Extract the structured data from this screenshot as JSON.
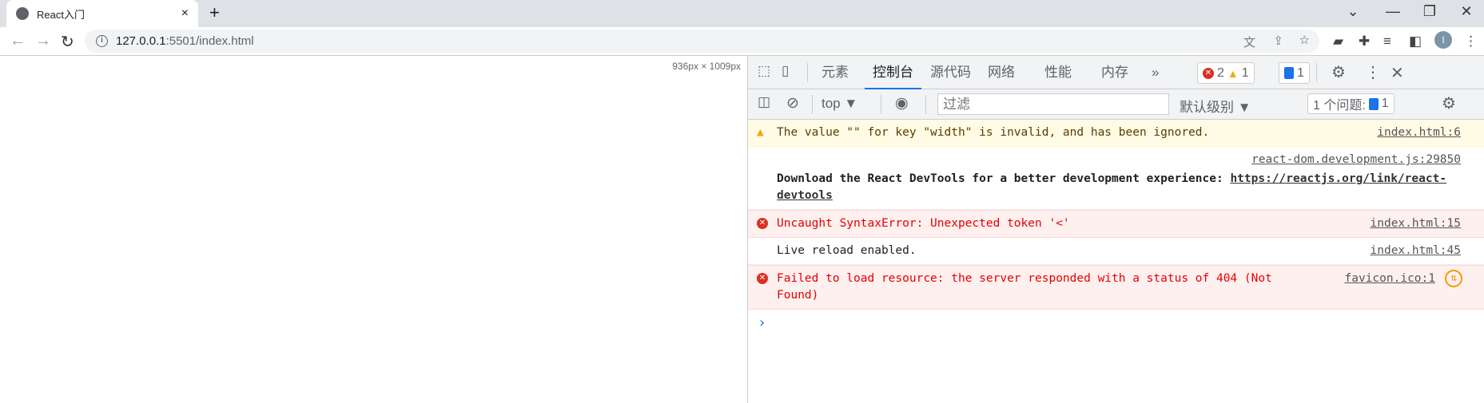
{
  "browser": {
    "tab_title": "React入门",
    "url_host": "127.0.0.1",
    "url_path": ":5501/index.html",
    "new_tab": "+",
    "tab_close": "×",
    "avatar_initial": "I"
  },
  "viewport": {
    "dimensions": "936px × 1009px"
  },
  "devtools": {
    "tabs": [
      "元素",
      "控制台",
      "源代码",
      "网络",
      "性能",
      "内存"
    ],
    "active_tab": "控制台",
    "more": "»",
    "error_count": "2",
    "warning_count": "1",
    "message_count": "1",
    "context": "top ▼",
    "filter_placeholder": "过滤",
    "level": "默认级别 ▼",
    "issues_label": "1 个问题:",
    "issues_count": "1",
    "colors": {
      "accent": "#1a73e8",
      "error": "#e50000",
      "warning_bg": "#fffbe5",
      "error_bg": "#fff0f0"
    }
  },
  "console": {
    "messages": [
      {
        "level": "warning",
        "text": "The value \"\" for key \"width\" is invalid, and has been ignored.",
        "source": "index.html:6"
      },
      {
        "level": "info",
        "source": "react-dom.development.js:29850",
        "text": "Download the React DevTools for a better development experience: ",
        "link": "https://reactjs.org/link/react-devtools"
      },
      {
        "level": "error",
        "text": "Uncaught SyntaxError: Unexpected token '<'",
        "source": "index.html:15"
      },
      {
        "level": "log",
        "text": "Live reload enabled.",
        "source": "index.html:45"
      },
      {
        "level": "error",
        "text": "Failed to load resource: the server responded with a status of 404 (Not Found)",
        "source": "favicon.ico:1"
      }
    ],
    "prompt": "›"
  }
}
